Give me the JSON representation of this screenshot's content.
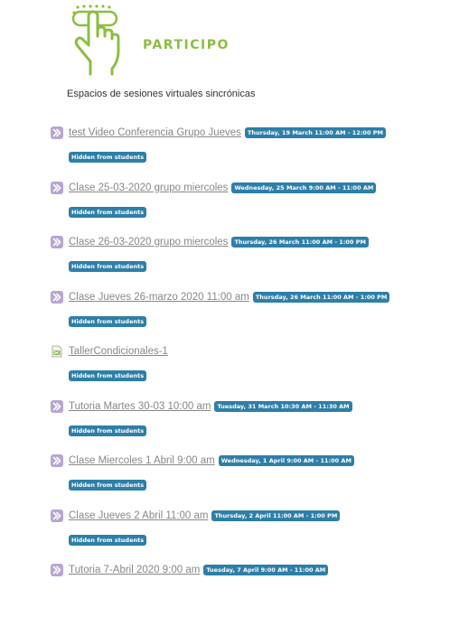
{
  "header": {
    "brand": "PARTICIPO",
    "subtitle": "Espacios de sesiones virtuales sincrónicas",
    "brand_color": "#8cbf3f"
  },
  "badge_color": "#2e7fa8",
  "activities": [
    {
      "name": "test Video Conferencia Grupo Jueves",
      "date": "Thursday, 19 March 11:00 AM - 12:00 PM",
      "status": "Hidden from students",
      "icon": "video-conference-icon"
    },
    {
      "name": "Clase 25-03-2020 grupo miercoles",
      "date": "Wednesday, 25 March 9:00 AM - 11:00 AM",
      "status": "Hidden from students",
      "icon": "video-conference-icon"
    },
    {
      "name": "Clase 26-03-2020 grupo miercoles",
      "date": "Thursday, 26 March 11:00 AM - 1:00 PM",
      "status": "Hidden from students",
      "icon": "video-conference-icon"
    },
    {
      "name": "Clase Jueves 26-marzo 2020 11:00 am",
      "date": "Thursday, 26 March 11:00 AM - 1:00 PM",
      "status": "Hidden from students",
      "icon": "video-conference-icon"
    },
    {
      "name": "TallerCondicionales-1",
      "date": "",
      "status": "Hidden from students",
      "icon": "spreadsheet-file-icon"
    },
    {
      "name": "Tutoria Martes 30-03 10:00 am",
      "date": "Tuesday, 31 March 10:30 AM - 11:30 AM",
      "status": "Hidden from students",
      "icon": "video-conference-icon"
    },
    {
      "name": "Clase Miercoles 1 Abril 9:00 am",
      "date": "Wednesday, 1 April 9:00 AM - 11:00 AM",
      "status": "Hidden from students",
      "icon": "video-conference-icon"
    },
    {
      "name": "Clase Jueves 2 Abril 11:00 am",
      "date": "Thursday, 2 April 11:00 AM - 1:00 PM",
      "status": "Hidden from students",
      "icon": "video-conference-icon"
    },
    {
      "name": "Tutoria 7-Abril 2020 9:00 am",
      "date": "Tuesday, 7 April 9:00 AM - 11:00 AM",
      "status": "",
      "icon": "video-conference-icon"
    }
  ]
}
